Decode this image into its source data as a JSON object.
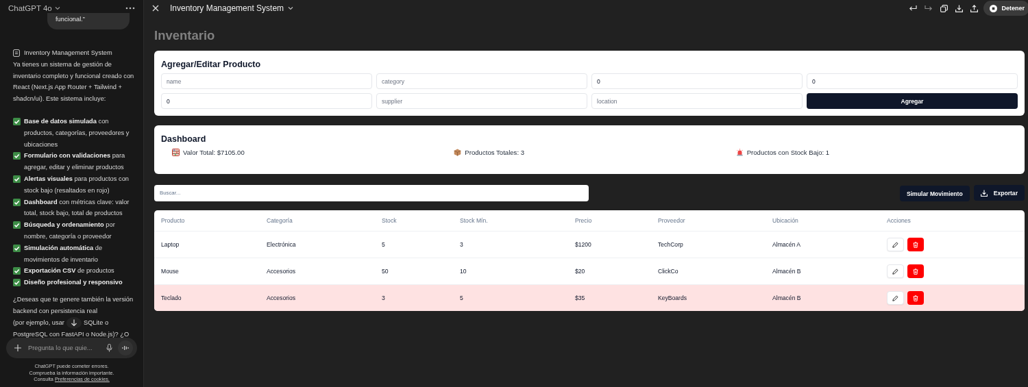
{
  "sidebar": {
    "model": "ChatGPT 4o",
    "user_message": "funcional.”",
    "canvas_ref": "Inventory Management System",
    "intro": "Ya tienes un sistema de gestión de inventario completo y funcional creado con React (Next.js App Router + Tailwind + shadcn/ui). Este sistema incluye:",
    "features": [
      "**Base de datos simulada** con productos, categorías, proveedores y ubicaciones",
      "**Formulario con validaciones** para agregar, editar y eliminar productos",
      "**Alertas visuales** para productos con stock bajo (resaltados en rojo)",
      "**Dashboard** con métricas clave: valor total, stock bajo, total de productos",
      "**Búsqueda y ordenamiento** por nombre, categoría o proveedor",
      "**Simulación automática** de movimientos de inventario",
      "**Exportación CSV** de productos",
      "**Diseño profesional y responsivo**"
    ],
    "question": [
      "¿Deseas que te genere también la versión backend con persistencia real",
      "(por ejemplo, usar",
      "SQLite o",
      "PostgreSQL con FastAPI o Node.js)? ¿O"
    ],
    "composer": {
      "placeholder": "Pregunta lo que quie..."
    },
    "disclaimer": [
      "ChatGPT puede cometer errores.",
      "Comprueba la información importante.",
      "Consulta"
    ],
    "cookie_link": "Preferencias de cookies."
  },
  "topbar": {
    "title": "Inventory Management System",
    "stop_button": "Detener"
  },
  "page": {
    "heading": "Inventario",
    "form": {
      "title": "Agregar/Editar Producto",
      "fields": [
        {
          "placeholder": "name"
        },
        {
          "placeholder": "category"
        },
        {
          "value": "0"
        },
        {
          "value": "0"
        },
        {
          "value": "0"
        },
        {
          "placeholder": "supplier"
        },
        {
          "placeholder": "location"
        }
      ],
      "submit": "Agregar"
    },
    "dashboard": {
      "title": "Dashboard",
      "metrics": [
        {
          "kind": "value",
          "text": "Valor Total: $7105.00"
        },
        {
          "kind": "count",
          "text": "Productos Totales: 3"
        },
        {
          "kind": "alert",
          "text": "Productos con Stock Bajo: 1"
        }
      ]
    },
    "search": {
      "placeholder": "Buscar..."
    },
    "buttons": [
      {
        "kind": "plain",
        "label": "Simular Movimiento"
      },
      {
        "kind": "export",
        "label": "Exportar"
      }
    ],
    "table": {
      "columns": [
        "Producto",
        "Categoría",
        "Stock",
        "Stock Mín.",
        "Precio",
        "Proveedor",
        "Ubicación",
        "Acciones"
      ],
      "rows": [
        {
          "cells": [
            "Laptop",
            "Electrónica",
            "5",
            "3",
            "$1200",
            "TechCorp",
            "Almacén A"
          ],
          "low_stock": false
        },
        {
          "cells": [
            "Mouse",
            "Accesorios",
            "50",
            "10",
            "$20",
            "ClickCo",
            "Almacén B"
          ],
          "low_stock": false
        },
        {
          "cells": [
            "Teclado",
            "Accesorios",
            "3",
            "5",
            "$35",
            "KeyBoards",
            "Almacén B"
          ],
          "low_stock": true
        }
      ]
    }
  }
}
